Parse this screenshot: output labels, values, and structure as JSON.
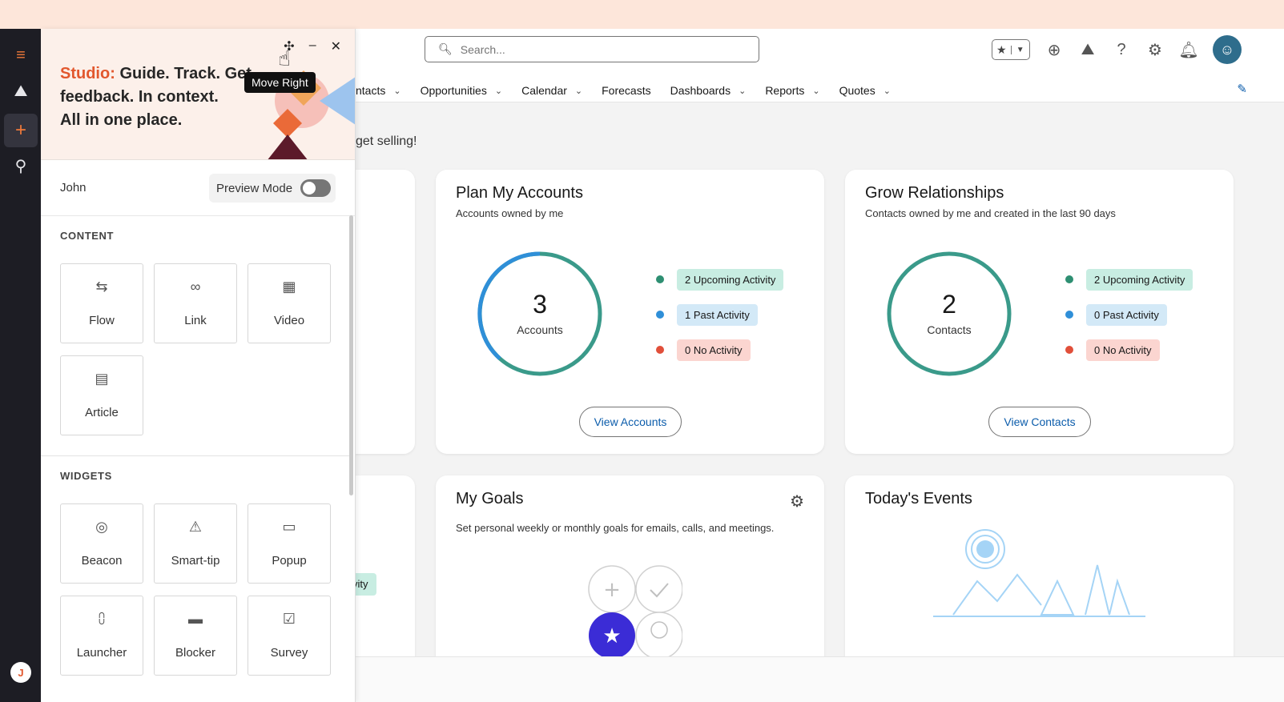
{
  "studio": {
    "hero_accent": "Studio:",
    "hero_line1": "Guide. Track. Get",
    "hero_line2": "feedback. In context.",
    "hero_line3": "All in one place.",
    "tooltip": "Move Right",
    "user_name": "John",
    "preview_label": "Preview Mode",
    "content_header": "CONTENT",
    "content_items": [
      {
        "label": "Flow",
        "icon": "signpost-icon"
      },
      {
        "label": "Link",
        "icon": "link-icon"
      },
      {
        "label": "Video",
        "icon": "film-icon"
      },
      {
        "label": "Article",
        "icon": "document-icon"
      }
    ],
    "widgets_header": "WIDGETS",
    "widget_items": [
      {
        "label": "Beacon",
        "icon": "beacon-icon"
      },
      {
        "label": "Smart-tip",
        "icon": "tip-icon"
      },
      {
        "label": "Popup",
        "icon": "popup-icon"
      },
      {
        "label": "Launcher",
        "icon": "launcher-icon"
      },
      {
        "label": "Blocker",
        "icon": "blocker-icon"
      },
      {
        "label": "Survey",
        "icon": "clipboard-icon"
      }
    ],
    "rail_avatar": "J"
  },
  "crm": {
    "search_placeholder": "Search...",
    "nav": [
      {
        "label": "ntacts"
      },
      {
        "label": "Opportunities"
      },
      {
        "label": "Calendar"
      },
      {
        "label": "Forecasts"
      },
      {
        "label": "Dashboards"
      },
      {
        "label": "Reports"
      },
      {
        "label": "Quotes"
      }
    ],
    "greeting": "get selling!",
    "plan_accounts": {
      "title": "Plan My Accounts",
      "subtitle": "Accounts owned by me",
      "count": "3",
      "count_label": "Accounts",
      "legend": [
        "2 Upcoming Activity",
        "1 Past Activity",
        "0 No Activity"
      ],
      "button": "View Accounts"
    },
    "grow_relationships": {
      "title": "Grow Relationships",
      "subtitle": "Contacts owned by me and created in the last 90 days",
      "count": "2",
      "count_label": "Contacts",
      "legend": [
        "2 Upcoming Activity",
        "0 Past Activity",
        "0 No Activity"
      ],
      "button": "View Contacts"
    },
    "my_goals": {
      "title": "My Goals",
      "subtitle": "Set personal weekly or monthly goals for emails, calls, and meetings."
    },
    "todays_events": {
      "title": "Today's Events"
    },
    "partial_pill": "vity"
  },
  "colors": {
    "brand_accent": "#e2572d",
    "ring_teal": "#3a9a8a",
    "ring_blue": "#2f8fd8",
    "dot_green": "#2e8f72",
    "dot_blue": "#2f8fd8",
    "dot_red": "#e14f3a",
    "link_blue": "#0b5cab"
  }
}
